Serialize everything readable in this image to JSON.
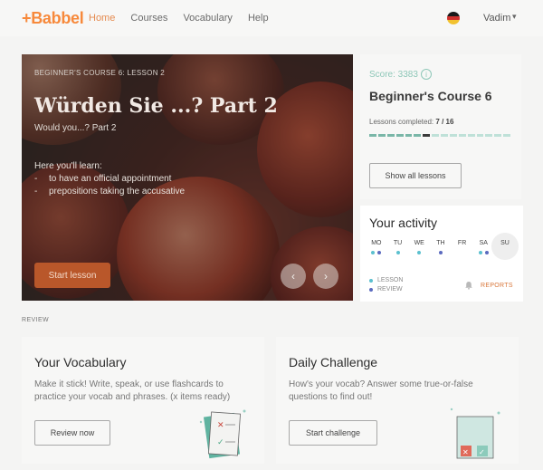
{
  "brand": {
    "logo": "+Babbel",
    "accent": "#f7893b"
  },
  "nav": {
    "items": [
      "Home",
      "Courses",
      "Vocabulary",
      "Help"
    ],
    "active": "Home"
  },
  "user": {
    "name": "Vadim",
    "flag": "germany-flag-icon"
  },
  "hero": {
    "kicker": "BEGINNER'S COURSE 6: LESSON 2",
    "title": "Würden Sie ...? Part 2",
    "subtitle": "Would you...? Part 2",
    "learn_heading": "Here you'll learn:",
    "learn_items": [
      "to have an official appointment",
      "prepositions taking the accusative"
    ],
    "start_label": "Start lesson",
    "prev_icon": "chevron-left-icon",
    "next_icon": "chevron-right-icon"
  },
  "course": {
    "score_label": "Score: 3383",
    "name": "Beginner's Course 6",
    "lessons_label": "Lessons completed:",
    "lessons_value": "7 / 16",
    "lessons_completed": 7,
    "lessons_total": 16,
    "button_label": "Show all lessons"
  },
  "activity": {
    "title": "Your activity",
    "days": [
      {
        "label": "MO",
        "dots": [
          "lesson",
          "review"
        ]
      },
      {
        "label": "TU",
        "dots": [
          "lesson"
        ]
      },
      {
        "label": "WE",
        "dots": [
          "lesson"
        ]
      },
      {
        "label": "TH",
        "dots": [
          "review"
        ]
      },
      {
        "label": "FR",
        "dots": []
      },
      {
        "label": "SA",
        "dots": [
          "lesson",
          "review"
        ]
      },
      {
        "label": "SU",
        "dots": []
      }
    ],
    "today": "SU",
    "legend_lesson": "LESSON",
    "legend_review": "REVIEW",
    "lesson_color": "#5bc0cf",
    "review_color": "#5b6abf",
    "reports_label": "REPORTS"
  },
  "review": {
    "section_label": "REVIEW",
    "vocab": {
      "title": "Your Vocabulary",
      "text": "Make it stick! Write, speak, or use flashcards to practice your vocab and phrases. (x items ready)",
      "button": "Review now"
    },
    "challenge": {
      "title": "Daily Challenge",
      "text": "How's your vocab? Answer some true-or-false questions to find out!",
      "button": "Start challenge"
    }
  }
}
